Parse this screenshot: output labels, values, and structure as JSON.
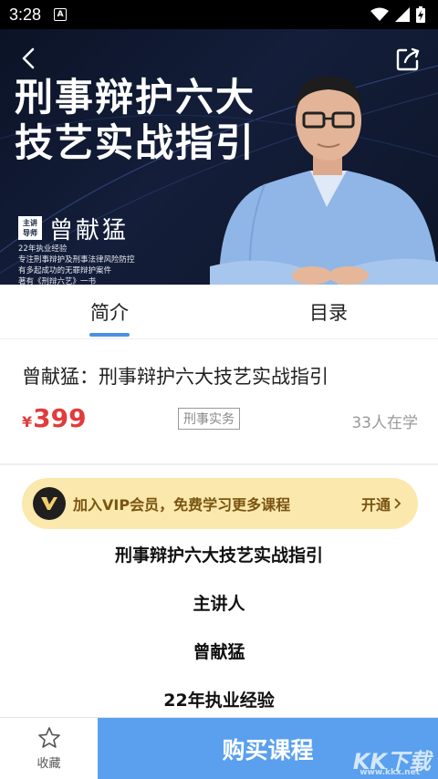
{
  "status_bar": {
    "time": "3:28",
    "notification_badge": "A"
  },
  "banner": {
    "title_line1": "刑事辩护六大",
    "title_line2": "技艺实战指引",
    "badge_line1": "主讲",
    "badge_line2": "导师",
    "lecturer_name": "曾献猛",
    "desc": [
      "22年执业经验",
      "专注刑事辩护及刑事法律风险防控",
      "有多起成功的无罪辩护案件",
      "著有《刑辩六艺》一书"
    ]
  },
  "tabs": [
    {
      "label": "简介",
      "active": true
    },
    {
      "label": "目录",
      "active": false
    }
  ],
  "course": {
    "title": "曾献猛：刑事辩护六大技艺实战指引",
    "currency": "¥",
    "price": "399",
    "tag": "刑事实务",
    "learners": "33人在学"
  },
  "vip": {
    "text": "加入VIP会员，免费学习更多课程",
    "action": "开通"
  },
  "description": [
    "刑事辩护六大技艺实战指引",
    "主讲人",
    "曾献猛",
    "22年执业经验"
  ],
  "bottom_bar": {
    "favorite_label": "收藏",
    "buy_label": "购买课程",
    "watermark": "KK下载",
    "watermark_url": "www.kkx.net"
  },
  "colors": {
    "accent_blue": "#5aa0ee",
    "price_red": "#e23b3b",
    "vip_bg": "#fbe8ad",
    "vip_text": "#7a5412"
  }
}
